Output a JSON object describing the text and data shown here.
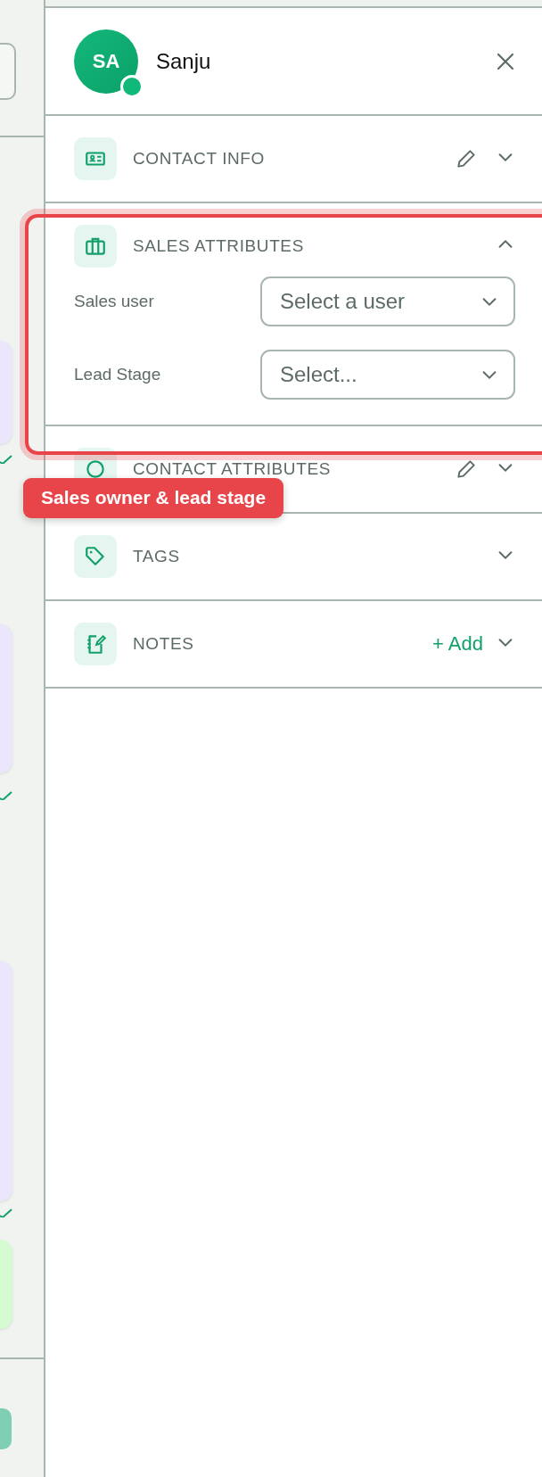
{
  "contact": {
    "initials": "SA",
    "name": "Sanju",
    "online": true
  },
  "sections": [
    {
      "title": "CONTACT INFO",
      "expanded": false,
      "editable": true
    },
    {
      "title": "SALES ATTRIBUTES",
      "expanded": true,
      "editable": false,
      "fields": [
        {
          "label": "Sales user",
          "placeholder": "Select a user"
        },
        {
          "label": "Lead Stage",
          "placeholder": "Select..."
        }
      ]
    },
    {
      "title": "CONTACT ATTRIBUTES",
      "expanded": false,
      "editable": true
    },
    {
      "title": "TAGS",
      "expanded": false,
      "editable": false
    },
    {
      "title": "NOTES",
      "expanded": false,
      "editable": false,
      "action": "+ Add"
    }
  ],
  "highlight": {
    "label": "Sales owner & lead stage"
  }
}
